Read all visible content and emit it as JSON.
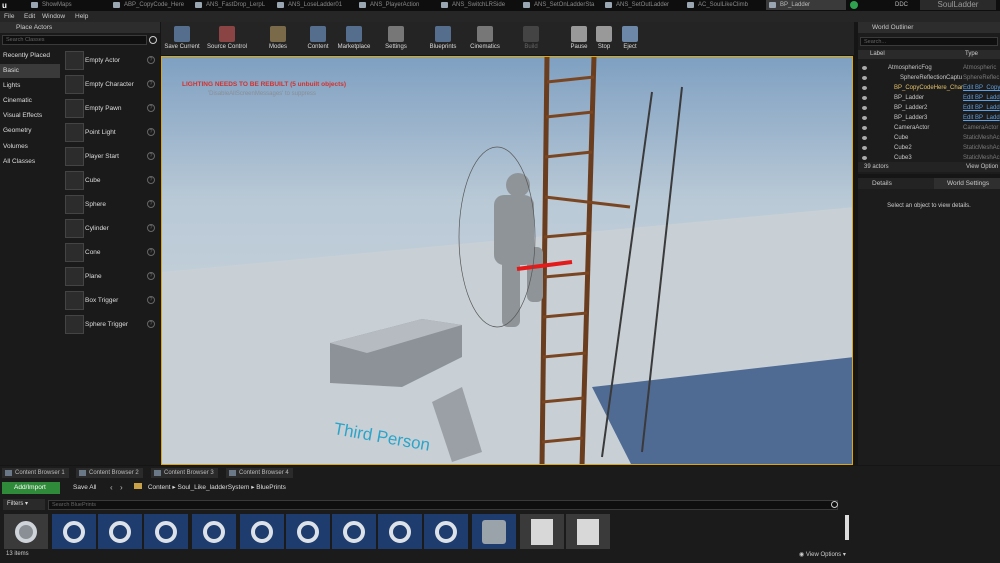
{
  "tabs": [
    "ShowMaps",
    "ABP_CopyCode_Here",
    "ANS_FastDrop_LerpL",
    "ANS_LoseLadder01",
    "ANS_PlayerAction",
    "ANS_SwitchLRSide",
    "ANS_SetOnLadderSta",
    "ANS_SetOutLadder",
    "AC_SoulLikeClimb",
    "BP_Ladder"
  ],
  "ddc": "DDC",
  "project_name": "SoulLadder",
  "menu": [
    "File",
    "Edit",
    "Window",
    "Help"
  ],
  "place_actors": {
    "title": "Place Actors",
    "search_placeholder": "Search Classes",
    "categories": [
      "Recently Placed",
      "Basic",
      "Lights",
      "Cinematic",
      "Visual Effects",
      "Geometry",
      "Volumes",
      "All Classes"
    ],
    "items": [
      "Empty Actor",
      "Empty Character",
      "Empty Pawn",
      "Point Light",
      "Player Start",
      "Cube",
      "Sphere",
      "Cylinder",
      "Cone",
      "Plane",
      "Box Trigger",
      "Sphere Trigger"
    ]
  },
  "toolbar": [
    "Save Current",
    "Source Control",
    "Modes",
    "Content",
    "Marketplace",
    "Settings",
    "Blueprints",
    "Cinematics",
    "Build",
    "Pause",
    "Stop",
    "Eject"
  ],
  "viewport": {
    "warning": "LIGHTING NEEDS TO BE REBUILT (5 unbuilt objects)",
    "warning_hint": "'DisableAllScreenMessages' to suppress",
    "label": "Third Person"
  },
  "outliner": {
    "title": "World Outliner",
    "search_placeholder": "Search...",
    "col_label": "Label",
    "col_type": "Type",
    "rows": [
      {
        "name": "AtmosphericFog",
        "type": "Atmospheric"
      },
      {
        "name": "SphereReflectionCaptu",
        "type": "SphereReflec"
      },
      {
        "name": "BP_CopyCodeHere_Char",
        "type": "Edit BP_Copy"
      },
      {
        "name": "BP_Ladder",
        "type": "Edit BP_Ladd"
      },
      {
        "name": "BP_Ladder2",
        "type": "Edit BP_Ladd"
      },
      {
        "name": "BP_Ladder3",
        "type": "Edit BP_Ladd"
      },
      {
        "name": "CameraActor",
        "type": "CameraActor"
      },
      {
        "name": "Cube",
        "type": "StaticMeshAc"
      },
      {
        "name": "Cube2",
        "type": "StaticMeshAc"
      },
      {
        "name": "Cube3",
        "type": "StaticMeshAc"
      }
    ],
    "count": "39 actors",
    "view_options": "View Option"
  },
  "details": {
    "tab1": "Details",
    "tab2": "World Settings",
    "empty": "Select an object to view details."
  },
  "content_browser": {
    "tabs": [
      "Content Browser 1",
      "Content Browser 2",
      "Content Browser 3",
      "Content Browser 4"
    ],
    "add_import": "Add/Import",
    "save_all": "Save All",
    "path": [
      "Content",
      "Soul_Like_ladderSystem",
      "BluePrints"
    ],
    "filters": "Filters",
    "search_placeholder": "Search BluePrints",
    "item_count": "13 items",
    "view_options": "View Options"
  }
}
